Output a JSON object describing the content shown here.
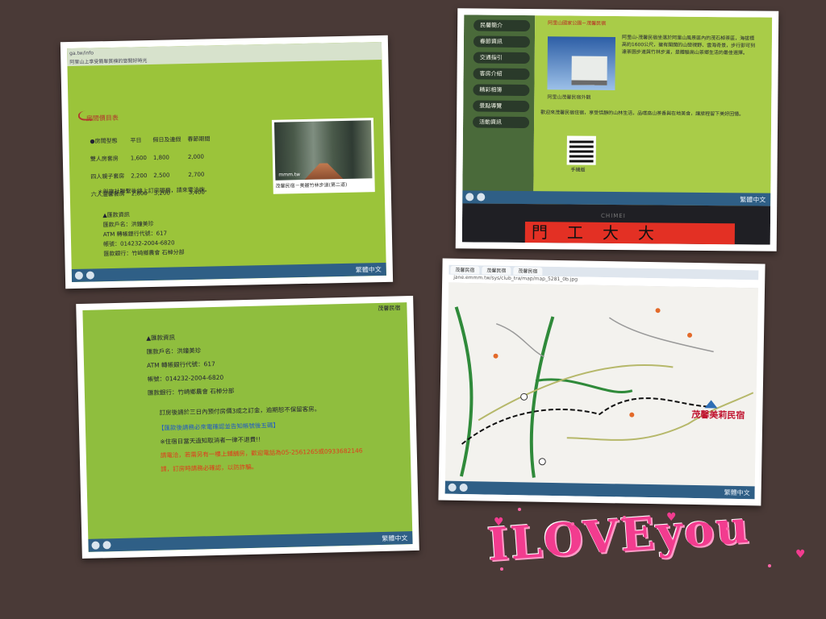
{
  "photo1": {
    "address": "ga.tw/info",
    "header_line": "阿里山上享受簡單質樸的悠閒好時光",
    "section_title": "房間價目表",
    "table_headers": [
      "●房間型態",
      "平日",
      "假日及連假",
      "春節期間"
    ],
    "rows": [
      [
        "雙人房套房",
        "1,600",
        "1,800",
        "2,000"
      ],
      [
        "四人親子套房",
        "2,200",
        "2,500",
        "2,700"
      ],
      [
        "六人溫馨套房",
        "2,800",
        "3,200",
        "3,400"
      ]
    ],
    "note": "＊與旅社聯繫後線上訂房服務，請來電洽詢。",
    "bank_title": "▲匯款資訊",
    "bank_lines": [
      "匯款戶名：洪鐘美珍",
      "ATM 轉帳銀行代號：617",
      "帳號：014232-2004-6820",
      "匯款銀行：竹崎鄉農會 石棹分部"
    ],
    "image_watermark": "mmm.tw",
    "image_caption": "茂馨民宿－美麗竹林步道(第二道)"
  },
  "photo2": {
    "nav_items": [
      "民馨簡介",
      "春節資訊",
      "交通指引",
      "客房介紹",
      "精彩相簿",
      "景點導覽",
      "活動資訊"
    ],
    "title": "阿里山國家公園－茂馨民宿",
    "image_caption": "阿里山茂馨民宿外觀",
    "para1": "阿里山-茂馨民宿坐落於阿里山風景區內的茂石棹茶區，海拔標高約1600公尺，擁有開闊的山巒視野、雲海奇景，步行即可到達茶園步道與竹林步道，是體驗高山茶鄉生活的最佳選擇。",
    "para2": "歡迎來茂馨民宿住宿，享受恬靜的山林生活，品嚐高山茶香與在地美食，讓旅程留下美好回憶。",
    "qr_label": "手機版",
    "chimei": "CHIMEI",
    "sign": "門工大大"
  },
  "photo3": {
    "corner": "茂馨民宿",
    "bank_title": "▲匯款資訊",
    "bank_lines": [
      "匯款戶名：洪鐘美珍",
      "ATM 轉帳銀行代號：617",
      "帳號：014232-2004-6820",
      "匯款銀行：竹崎鄉農會 石棹分部"
    ],
    "msg1": "訂房後請於三日內預付房價3成之訂金，逾期恕不保留客房。",
    "link": "【匯款後請務必來電確認並告知帳號後五碼】",
    "msg2": "※住宿日當天過知取消者一律不退費!!",
    "red1": "請電洽，若需另有一樓上鋪舖房，歡迎電話為05-2561265或0933682146",
    "red2": "請，訂房時請務必確認，以防詐騙。"
  },
  "photo4": {
    "tabs": [
      "茂馨民宿",
      "茂馨民宿",
      "茂馨民宿"
    ],
    "address": "jane.emmm.tw/sys/club_tra/map/map_5281_0b.jpg",
    "lodge_label": "茂馨美莉民宿"
  },
  "love_text": "ILOVEyou",
  "taskbar_text": "繁體中文"
}
